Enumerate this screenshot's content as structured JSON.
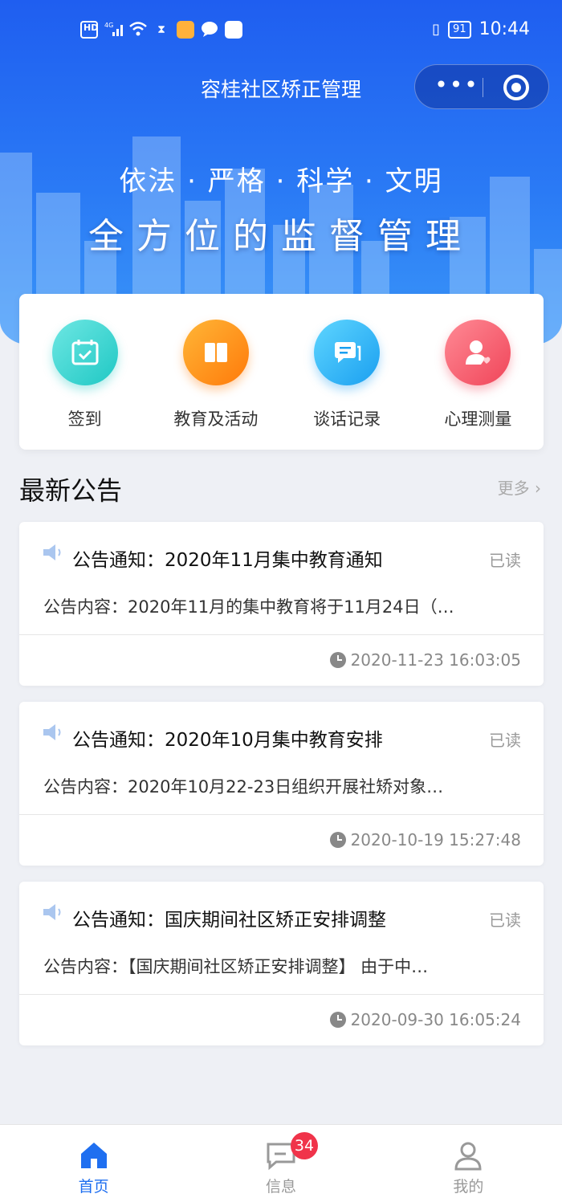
{
  "status_bar": {
    "time": "10:44",
    "battery": "91",
    "network": "4G",
    "hd": "HD"
  },
  "nav": {
    "title": "容桂社区矫正管理",
    "more_icon": "more-dots-icon",
    "close_icon": "target-icon"
  },
  "banner": {
    "slogan_line1": "依法 · 严格 · 科学 · 文明",
    "slogan_line2": "全方位的监督管理"
  },
  "menu": [
    {
      "label": "签到",
      "icon": "calendar-check-icon",
      "color": "#1fc8c4"
    },
    {
      "label": "教育及活动",
      "icon": "book-icon",
      "color": "#ff7a0a"
    },
    {
      "label": "谈话记录",
      "icon": "chat-icon",
      "color": "#1a9ff0"
    },
    {
      "label": "心理测量",
      "icon": "person-heart-icon",
      "color": "#f04559"
    }
  ],
  "announcements": {
    "section_title": "最新公告",
    "more_label": "更多",
    "items": [
      {
        "title": "公告通知：2020年11月集中教育通知",
        "status": "已读",
        "content": "公告内容：2020年11月的集中教育将于11月24日（…",
        "time": "2020-11-23 16:03:05"
      },
      {
        "title": "公告通知：2020年10月集中教育安排",
        "status": "已读",
        "content": "公告内容：2020年10月22-23日组织开展社矫对象…",
        "time": "2020-10-19 15:27:48"
      },
      {
        "title": "公告通知：国庆期间社区矫正安排调整",
        "status": "已读",
        "content": "公告内容：【国庆期间社区矫正安排调整】 由于中…",
        "time": "2020-09-30 16:05:24"
      }
    ]
  },
  "tabbar": {
    "tabs": [
      {
        "label": "首页",
        "icon": "home-icon",
        "active": true
      },
      {
        "label": "信息",
        "icon": "message-icon",
        "active": false
      },
      {
        "label": "我的",
        "icon": "user-icon",
        "active": false
      }
    ],
    "message_badge": "34"
  },
  "colors": {
    "primary": "#1f6ff0",
    "badge": "#f0334a"
  }
}
